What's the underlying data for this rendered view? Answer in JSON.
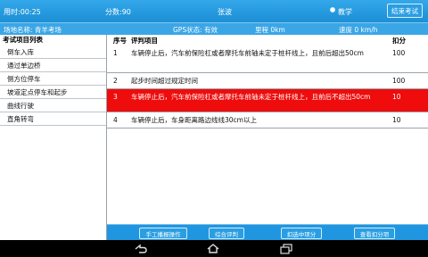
{
  "topbar": {
    "time": "用时:00:25",
    "score": "分数:90",
    "name": "张波",
    "mode": "教学",
    "end_button": "结束考试"
  },
  "infobar": {
    "venue": "场地名称: 青羊考场",
    "gps": "GPS状态: 有效",
    "mileage": "里程 0km",
    "speed": "速度 0 km/h"
  },
  "sidebar": {
    "title": "考试项目列表",
    "items": [
      {
        "label": "倒车入库"
      },
      {
        "label": "通过单边桥"
      },
      {
        "label": "侧方位停车"
      },
      {
        "label": "坡道定点停车和起步"
      },
      {
        "label": "曲线行驶"
      },
      {
        "label": "直角转弯"
      }
    ]
  },
  "table": {
    "headers": {
      "no": "序号",
      "item": "评判项目",
      "score": "扣分"
    },
    "rows": [
      {
        "no": "1",
        "item": "车辆停止后，汽车前保险杠或者摩托车前轴未定于桩杆线上，且前后超出50cm",
        "score": "100"
      },
      {
        "no": "2",
        "item": "起步时间超过规定时间",
        "score": "100"
      },
      {
        "no": "3",
        "item": "车辆停止后，汽车前保险杠或者摩托车前轴未定于桩杆线上，且前后不超出50cm",
        "score": "10"
      },
      {
        "no": "4",
        "item": "车辆停止后，车身距离路边线线30cm以上",
        "score": "10"
      }
    ]
  },
  "bottom_buttons": {
    "manual": "手工播报操作",
    "overall": "综合评判",
    "deduct": "扣选中项分",
    "view": "查看扣分项"
  },
  "colors": {
    "header_blue": "#1c8fd5",
    "selected_row": "#ee0c0c"
  }
}
